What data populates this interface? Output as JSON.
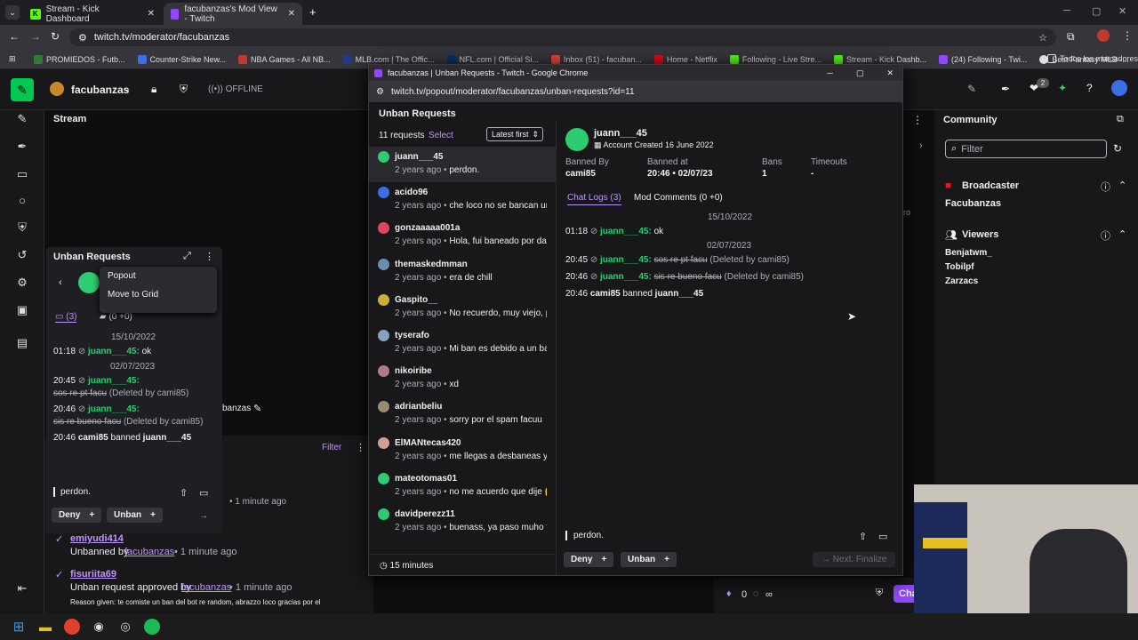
{
  "browser": {
    "tabs": [
      {
        "label": "Stream - Kick Dashboard"
      },
      {
        "label": "facubanzas's Mod View - Twitch"
      }
    ],
    "url": "twitch.tv/moderator/facubanzas",
    "bookmarks": [
      "PROMIEDOS - Futb...",
      "Counter-Strike New...",
      "NBA Games - All NB...",
      "MLB.com | The Offic...",
      "NFL.com | Official Si...",
      "Inbox (51) - facuban...",
      "Home - Netflix",
      "Following - Live Stre...",
      "Stream - Kick Dashb...",
      "(24) Following - Twi...",
      "Best Fantasy MLB -..."
    ],
    "bookmarks_all": "Todos los marcadores"
  },
  "twitch": {
    "channel": "facubanzas",
    "status": "OFFLINE",
    "stream_label": "Stream",
    "notif_count": "2",
    "community": {
      "title": "Community",
      "filter_placeholder": "Filter",
      "broadcaster_label": "Broadcaster",
      "broadcaster": "Facubanzas",
      "viewers_label": "Viewers",
      "viewers": [
        "Benjatwm_",
        "Tobilpf",
        "Zarzacs"
      ]
    },
    "bottom": {
      "filter": "Filter",
      "channel_short": "banzas",
      "entries": [
        {
          "user": "emiyudi414",
          "text": "Unbanned by",
          "by": "facubanzas",
          "time": "• 1 minute ago"
        },
        {
          "user": "fisuriita69",
          "text": "Unban request approved by",
          "by": "facubanzas",
          "time": "• 1 minute ago"
        }
      ],
      "reason": "Reason given: te comiste un ban del bot re random, abrazzo loco gracias por el",
      "time1": "• 1 minute ago"
    },
    "right_bottom": {
      "count": "0",
      "infinity": "∞",
      "chat": "Cha"
    }
  },
  "mini": {
    "title": "Unban Requests",
    "menu": [
      "Popout",
      "Move to Grid"
    ],
    "tab_logs": "(3)",
    "tab_comments": "(0 +0)",
    "date1": "15/10/2022",
    "date2": "02/07/2023",
    "logs": [
      {
        "t": "01:18",
        "u": "juann___45:",
        "m": "ok"
      },
      {
        "t": "20:45",
        "u": "juann___45:",
        "m": "sos re pt facu",
        "d": "(Deleted by cami85)"
      },
      {
        "t": "20:46",
        "u": "juann___45:",
        "m": "sis re bueno facu",
        "d": "(Deleted by cami85)"
      }
    ],
    "ban": {
      "t": "20:46",
      "by": "cami85",
      "word": "banned",
      "u": "juann___45"
    },
    "input": "perdon.",
    "deny": "Deny",
    "unban": "Unban"
  },
  "popup": {
    "window_title": "facubanzas | Unban Requests - Twitch - Google Chrome",
    "url": "twitch.tv/popout/moderator/facubanzas/unban-requests?id=11",
    "heading": "Unban Requests",
    "count": "11 requests",
    "select": "Select",
    "sort": "Latest first",
    "requests": [
      {
        "name": "juann___45",
        "time": "2 years ago",
        "msg": "perdon.",
        "color": "#2ecc71"
      },
      {
        "name": "acido96",
        "time": "2 years ago",
        "msg": "che loco no se bancan una",
        "color": "#3a6ee8"
      },
      {
        "name": "gonzaaaaa001a",
        "time": "2 years ago",
        "msg": "Hola, fui baneado por dar s",
        "color": "#e0455c"
      },
      {
        "name": "themaskedmman",
        "time": "2 years ago",
        "msg": "era de chill",
        "color": "#6a8fb0"
      },
      {
        "name": "Gaspito__",
        "time": "2 years ago",
        "msg": "No recuerdo, muy viejo, pe",
        "color": "#c9b030"
      },
      {
        "name": "tyserafo",
        "time": "2 years ago",
        "msg": "Mi ban es debido a un ban",
        "color": "#8aa0c0"
      },
      {
        "name": "nikoiribe",
        "time": "2 years ago",
        "msg": "xd",
        "color": "#b07a8a"
      },
      {
        "name": "adrianbeliu",
        "time": "2 years ago",
        "msg": "sorry por el spam facuu",
        "color": "#9a8a70"
      },
      {
        "name": "ElMANtecas420",
        "time": "2 years ago",
        "msg": "me llegas a desbaneas y s",
        "color": "#d0a090"
      },
      {
        "name": "mateotomas01",
        "time": "2 years ago",
        "msg": "no me acuerdo que dije 🤔",
        "color": "#2ecc71"
      },
      {
        "name": "davidperezz11",
        "time": "2 years ago",
        "msg": "buenass, ya paso muho tie",
        "color": "#2ecc71"
      }
    ],
    "footer": "15 minutes",
    "detail": {
      "user": "juann___45",
      "created": "Account Created 16 June 2022",
      "banned_by_label": "Banned By",
      "banned_by": "cami85",
      "banned_at_label": "Banned at",
      "banned_at": "20:46 • 02/07/23",
      "bans_label": "Bans",
      "bans": "1",
      "timeouts_label": "Timeouts",
      "timeouts": "-",
      "tab_logs": "Chat Logs (3)",
      "tab_comments": "Mod Comments (0 +0)",
      "date1": "15/10/2022",
      "date2": "02/07/2023",
      "logs": [
        {
          "t": "01:18",
          "u": "juann___45:",
          "m": "ok"
        },
        {
          "t": "20:45",
          "u": "juann___45:",
          "m": "sos re pt facu",
          "d": "(Deleted by cami85)"
        },
        {
          "t": "20:46",
          "u": "juann___45:",
          "m": "sis re bueno facu",
          "d": "(Deleted by cami85)"
        }
      ],
      "ban": {
        "t": "20:46",
        "by": "cami85",
        "word": "banned",
        "u": "juann___45"
      },
      "input": "perdon.",
      "deny": "Deny",
      "unban": "Unban",
      "next": "Next: Finalize"
    }
  },
  "colors": {
    "twitch_purple": "#9147ff",
    "green": "#2ecc71",
    "kick": "#53fc18"
  }
}
